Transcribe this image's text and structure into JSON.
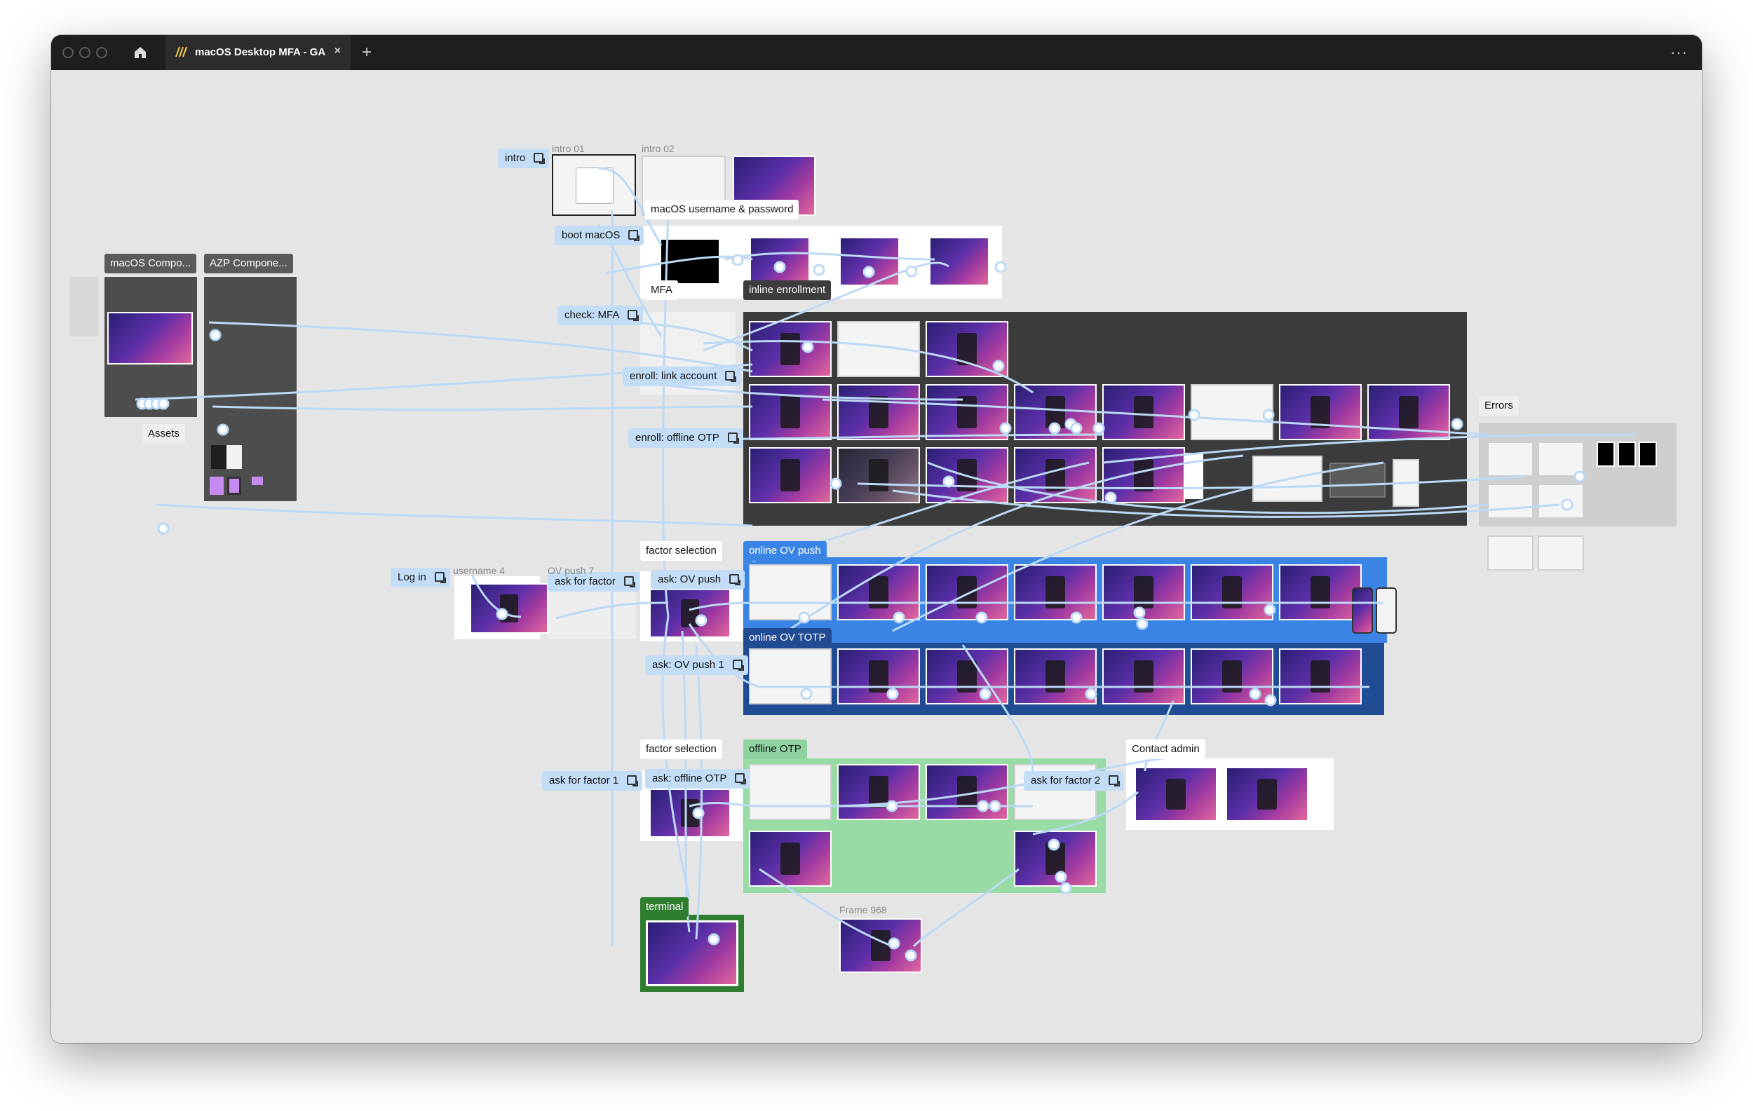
{
  "window": {
    "tab_title": "macOS Desktop MFA - GA",
    "new_tab": "+",
    "more": "···",
    "close": "×"
  },
  "labels": {
    "intro": "intro",
    "boot": "boot macOS",
    "check_mfa": "check: MFA",
    "enroll_account": "enroll: link account",
    "enroll_offline": "enroll: offline OTP",
    "log_in": "Log in",
    "ask_factor": "ask for factor",
    "ask_ov_push": "ask: OV push",
    "ask_ov_push_1": "ask: OV push 1",
    "ask_factor_1": "ask for factor 1",
    "ask_offline_otp": "ask: offline OTP",
    "ask_factor_2": "ask for factor 2"
  },
  "tags": {
    "macos_components": "macOS Compo...",
    "azp_components": "AZP Compone...",
    "assets": "Assets",
    "username_password": "macOS username & password",
    "mfa": "MFA",
    "inline_enrollment": "inline enrollment",
    "errors": "Errors",
    "factor_selection": "factor selection",
    "online_ov_push": "online OV push",
    "online_ov_totp": "online OV TOTP",
    "factor_selection_2": "factor selection",
    "offline_otp": "offline OTP",
    "contact_admin": "Contact admin",
    "terminal": "terminal"
  },
  "frame_names": {
    "intro_01": "intro 01",
    "intro_02": "intro 02",
    "username_4": "username 4",
    "ov_push_7": "OV push 7",
    "frame_968": "Frame 968"
  },
  "colors": {
    "canvas": "#e5e5e5",
    "titlebar": "#1e1e1e",
    "flow_label": "#c3ddf6",
    "connector": "#bcd9f5",
    "enrollment_bg": "#3b3b3b",
    "ov_push": "#3a84e6",
    "ov_totp": "#1f4c93",
    "offline_otp": "#98dba4",
    "terminal": "#2f7d2f",
    "wallpaper": "#5b2fa8"
  }
}
